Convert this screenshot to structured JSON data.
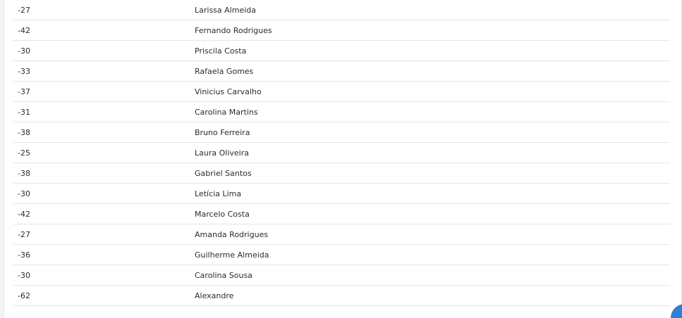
{
  "table": {
    "rows": [
      {
        "age": "-27",
        "name": "Larissa Almeida"
      },
      {
        "age": "-42",
        "name": "Fernando Rodrigues"
      },
      {
        "age": "-30",
        "name": "Priscila Costa"
      },
      {
        "age": "-33",
        "name": "Rafaela Gomes"
      },
      {
        "age": "-37",
        "name": "Vinicius Carvalho"
      },
      {
        "age": "-31",
        "name": "Carolina Martins"
      },
      {
        "age": "-38",
        "name": "Bruno Ferreira"
      },
      {
        "age": "-25",
        "name": "Laura Oliveira"
      },
      {
        "age": "-38",
        "name": "Gabriel Santos"
      },
      {
        "age": "-30",
        "name": "Letícia Lima"
      },
      {
        "age": "-42",
        "name": "Marcelo Costa"
      },
      {
        "age": "-27",
        "name": "Amanda Rodrigues"
      },
      {
        "age": "-36",
        "name": "Guilherme Almeida"
      },
      {
        "age": "-30",
        "name": "Carolina Sousa"
      },
      {
        "age": "-62",
        "name": "Alexandre"
      }
    ]
  },
  "colors": {
    "accent": "#2f80d1",
    "row_border": "#e3e5e8",
    "text": "#2b2b2b"
  },
  "icons": {
    "floating_action": "circle-action-button"
  }
}
